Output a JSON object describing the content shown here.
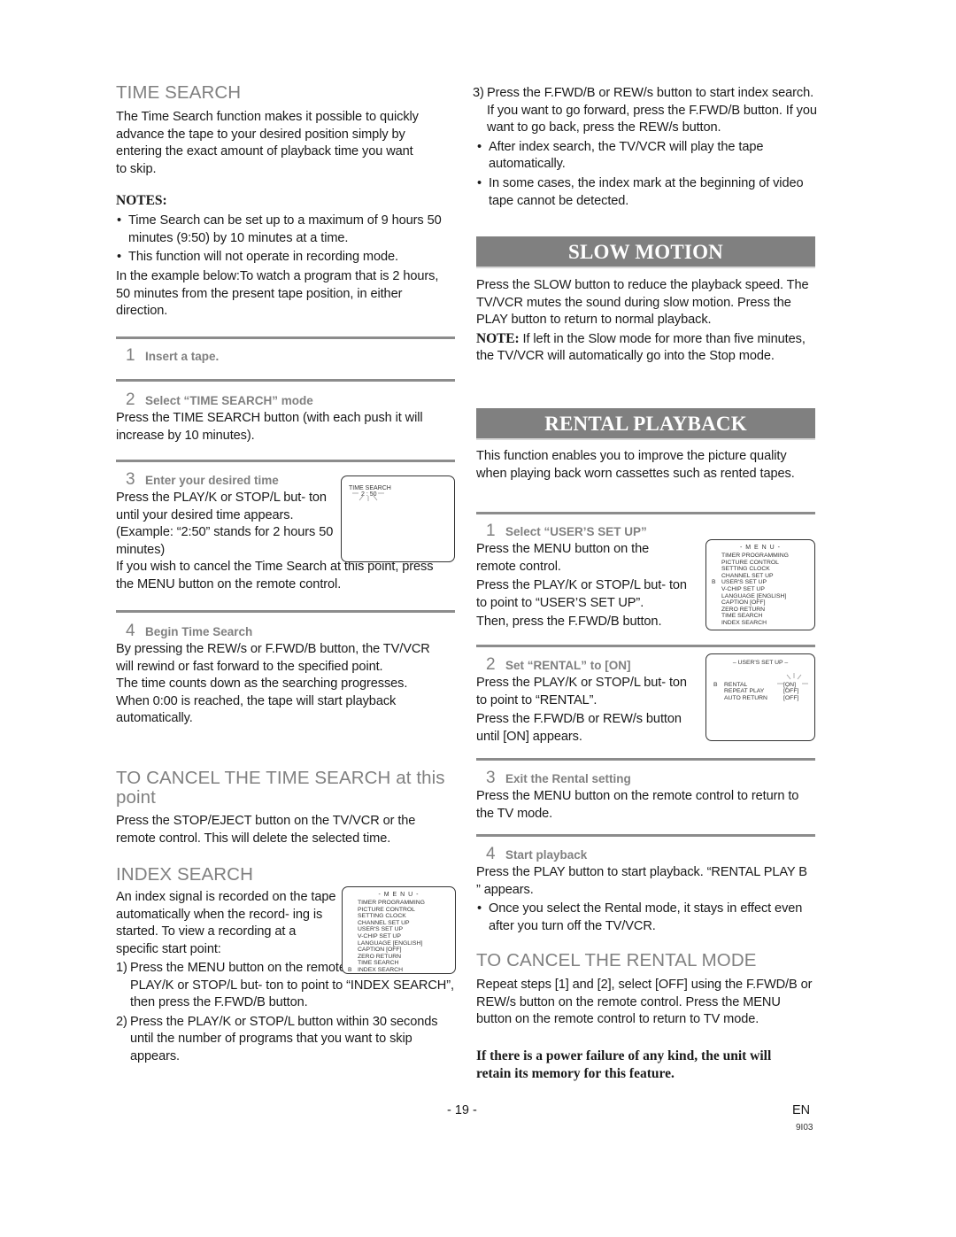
{
  "time_search": {
    "heading": "TIME SEARCH",
    "intro": "The Time Search function makes it possible to quickly advance the tape to your desired position simply by entering the exact amount of playback time you want to skip.",
    "notes_heading": "NOTES:",
    "notes": [
      "Time Search can be set up to a maximum of 9 hours 50 minutes (9:50) by 10 minutes at a time.",
      "This function will not operate in recording mode."
    ],
    "example": "In the example below:To watch a program that is 2 hours, 50 minutes from the present tape position, in either direction.",
    "steps": [
      {
        "num": "1",
        "title": "Insert a tape.",
        "body": ""
      },
      {
        "num": "2",
        "title": "Select “TIME SEARCH” mode",
        "body": "Press the TIME SEARCH button (with each push it will increase by 10 minutes)."
      },
      {
        "num": "3",
        "title": "Enter your desired time",
        "body": "Press the PLAY/K or STOP/L but- ton until your desired time appears. (Example: “2:50” stands for 2 hours 50 minutes)",
        "body2": "If you wish to cancel the Time Search at this point, press the MENU button on the remote control."
      },
      {
        "num": "4",
        "title": "Begin Time Search",
        "body": "By pressing the REW/s or F.FWD/B button, the TV/VCR will rewind or fast forward to the specified point.",
        "body2": "The time counts down as the searching progresses. When 0:00 is reached, the tape will start playback automatically."
      }
    ],
    "osd": {
      "title": "TIME SEARCH",
      "value": "2 : 50"
    }
  },
  "cancel_time_search": {
    "heading": "TO CANCEL THE TIME SEARCH at this point",
    "body": "Press the STOP/EJECT button on the TV/VCR or the remote control. This will delete the selected time."
  },
  "index_search": {
    "heading": "INDEX SEARCH",
    "intro": "An index signal is recorded on the tape automatically when the record- ing is started. To view a recording at a specific start point:",
    "items": [
      {
        "num": "1)",
        "text": "Press the MENU button on the remote control. Press the PLAY/K or STOP/L but- ton to point to “INDEX SEARCH”, then press the F.FWD/B button."
      },
      {
        "num": "2)",
        "text": "Press the PLAY/K or STOP/L button within 30 seconds until the number of programs that you want to skip appears."
      },
      {
        "num": "3)",
        "text": "Press the F.FWD/B or REW/s button to start index search. If you want to go forward, press the F.FWD/B button. If you want to go back, press the REW/s button."
      }
    ],
    "bullets": [
      "After index search, the TV/VCR will play the tape automatically.",
      "In some cases, the index mark at the beginning of video tape cannot be detected."
    ]
  },
  "menu_osd": {
    "title": "- M E N U -",
    "pointer": "B",
    "items": [
      "TIMER PROGRAMMING",
      "PICTURE CONTROL",
      "SETTING CLOCK",
      "CHANNEL SET UP",
      "USER'S SET UP",
      "V-CHIP SET UP",
      "LANGUAGE  [ENGLISH]",
      "CAPTION  [OFF]",
      "ZERO RETURN",
      "TIME SEARCH",
      "INDEX SEARCH"
    ]
  },
  "slow_motion": {
    "banner": "SLOW MOTION",
    "body": "Press the SLOW button to reduce the playback speed. The TV/VCR mutes the sound during slow motion. Press the PLAY button to return to normal playback.",
    "note_label": "NOTE:",
    "note": " If left in the Slow mode for more than five minutes, the TV/VCR will automatically go into the Stop mode."
  },
  "rental_playback": {
    "banner": "RENTAL PLAYBACK",
    "intro": "This function enables you to improve the picture quality when playing back worn cassettes such as rented tapes.",
    "steps": [
      {
        "num": "1",
        "title": "Select “USER’S SET UP”",
        "body": "Press the MENU button on the remote control.",
        "body2": "Press the PLAY/K or STOP/L but- ton to point to “USER’S SET UP”.",
        "body3": "Then, press the F.FWD/B button."
      },
      {
        "num": "2",
        "title": "Set “RENTAL” to [ON]",
        "body": "Press the PLAY/K or STOP/L but- ton to point to “RENTAL”.",
        "body2": "Press the F.FWD/B or REW/s button until [ON] appears."
      },
      {
        "num": "3",
        "title": "Exit the Rental setting",
        "body": "Press the MENU button on the remote control to return to the TV mode."
      },
      {
        "num": "4",
        "title": "Start playback",
        "body": "Press the PLAY button to start playback. “RENTAL PLAY B ” appears.",
        "bullet": "Once you select the Rental mode, it stays in effect even after you turn off the TV/VCR."
      }
    ],
    "users_osd": {
      "title": "– USER'S SET UP –",
      "pointer": "B",
      "rows": [
        {
          "label": "RENTAL",
          "value": "[ON]"
        },
        {
          "label": "REPEAT PLAY",
          "value": "[OFF]"
        },
        {
          "label": "AUTO RETURN",
          "value": "[OFF]"
        }
      ]
    }
  },
  "cancel_rental": {
    "heading": "TO CANCEL THE RENTAL MODE",
    "body": "Repeat steps [1] and [2], select [OFF] using the F.FWD/B or REW/s button on the remote control. Press the MENU button on the remote control to return to TV mode.",
    "bold_note": "If there is a power failure of any kind, the unit will retain its memory for this feature."
  },
  "footer": {
    "page": "- 19 -",
    "lang": "EN",
    "code": "9I03"
  }
}
